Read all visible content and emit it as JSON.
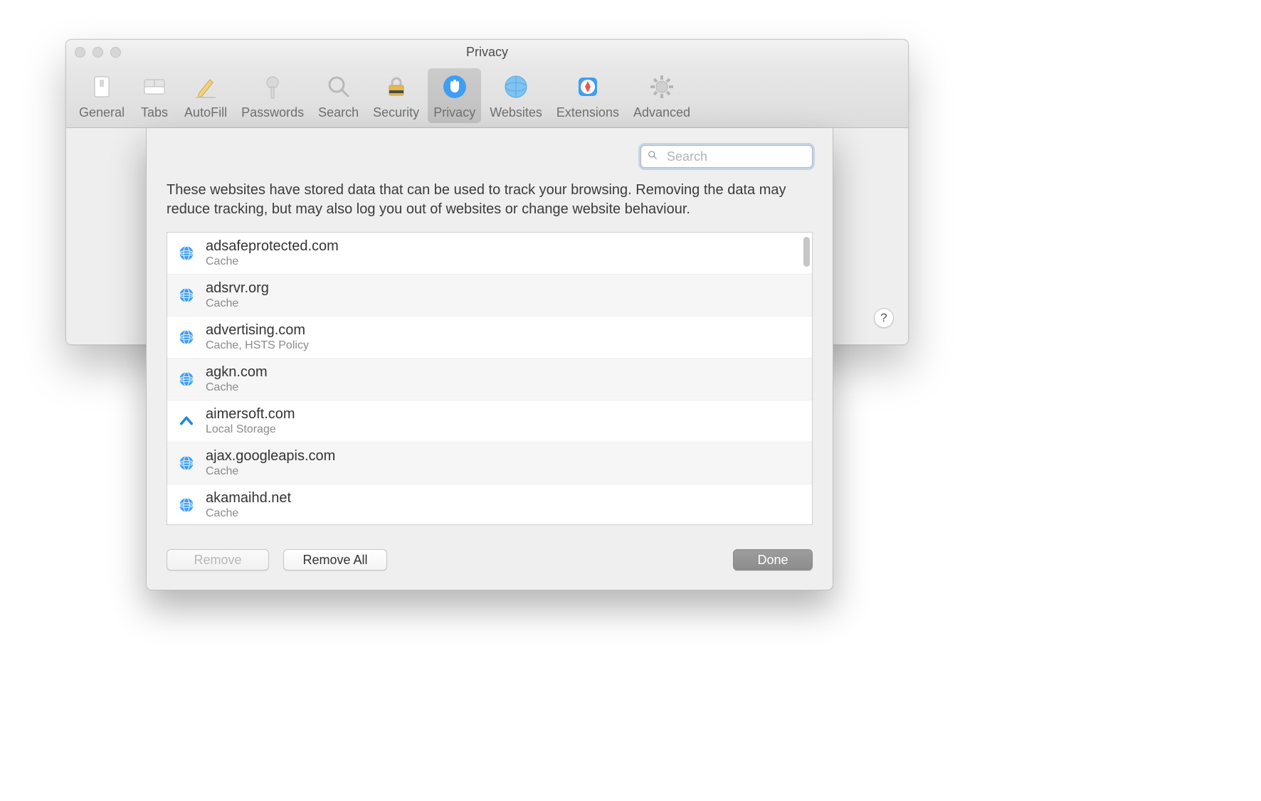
{
  "window": {
    "title": "Privacy"
  },
  "toolbar": {
    "items": [
      {
        "label": "General"
      },
      {
        "label": "Tabs"
      },
      {
        "label": "AutoFill"
      },
      {
        "label": "Passwords"
      },
      {
        "label": "Search"
      },
      {
        "label": "Security"
      },
      {
        "label": "Privacy"
      },
      {
        "label": "Websites"
      },
      {
        "label": "Extensions"
      },
      {
        "label": "Advanced"
      }
    ]
  },
  "sheet": {
    "search_placeholder": "Search",
    "description": "These websites have stored data that can be used to track your browsing. Removing the data may reduce tracking, but may also log you out of websites or change website behaviour.",
    "sites": [
      {
        "domain": "adsafeprotected.com",
        "detail": "Cache",
        "icon": "globe"
      },
      {
        "domain": "adsrvr.org",
        "detail": "Cache",
        "icon": "globe"
      },
      {
        "domain": "advertising.com",
        "detail": "Cache, HSTS Policy",
        "icon": "globe"
      },
      {
        "domain": "agkn.com",
        "detail": "Cache",
        "icon": "globe"
      },
      {
        "domain": "aimersoft.com",
        "detail": "Local Storage",
        "icon": "chevron"
      },
      {
        "domain": "ajax.googleapis.com",
        "detail": "Cache",
        "icon": "globe"
      },
      {
        "domain": "akamaihd.net",
        "detail": "Cache",
        "icon": "globe"
      }
    ],
    "buttons": {
      "remove": "Remove",
      "remove_all": "Remove All",
      "done": "Done"
    }
  },
  "help_button": "?"
}
